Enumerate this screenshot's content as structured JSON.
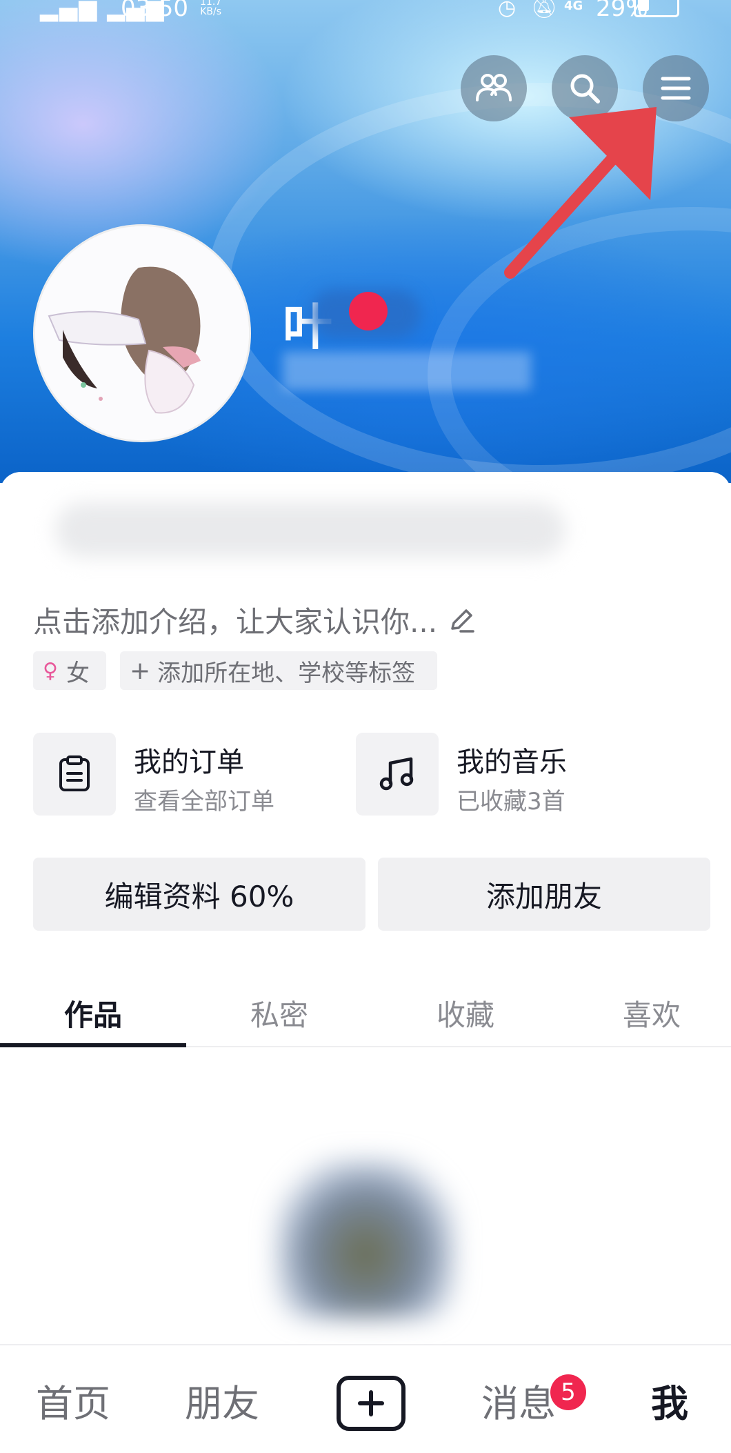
{
  "status_bar": {
    "time": "03:50",
    "network_speed_value": "11.7",
    "network_speed_unit": "KB/s",
    "battery": "29%"
  },
  "header": {
    "nickname": "叶"
  },
  "bio": {
    "prompt": "点击添加介绍，让大家认识你..."
  },
  "tags": {
    "gender": "女",
    "add_tag": "添加所在地、学校等标签"
  },
  "services": [
    {
      "title": "我的订单",
      "subtitle": "查看全部订单"
    },
    {
      "title": "我的音乐",
      "subtitle": "已收藏3首"
    }
  ],
  "buttons": {
    "edit_profile": "编辑资料 60%",
    "add_friend": "添加朋友"
  },
  "tabs": [
    "作品",
    "私密",
    "收藏",
    "喜欢"
  ],
  "bottom_nav": {
    "home": "首页",
    "friends": "朋友",
    "messages": "消息",
    "messages_badge": "5",
    "me": "我"
  },
  "colors": {
    "accent": "#f0264f",
    "annotation_arrow": "#e5444b"
  }
}
